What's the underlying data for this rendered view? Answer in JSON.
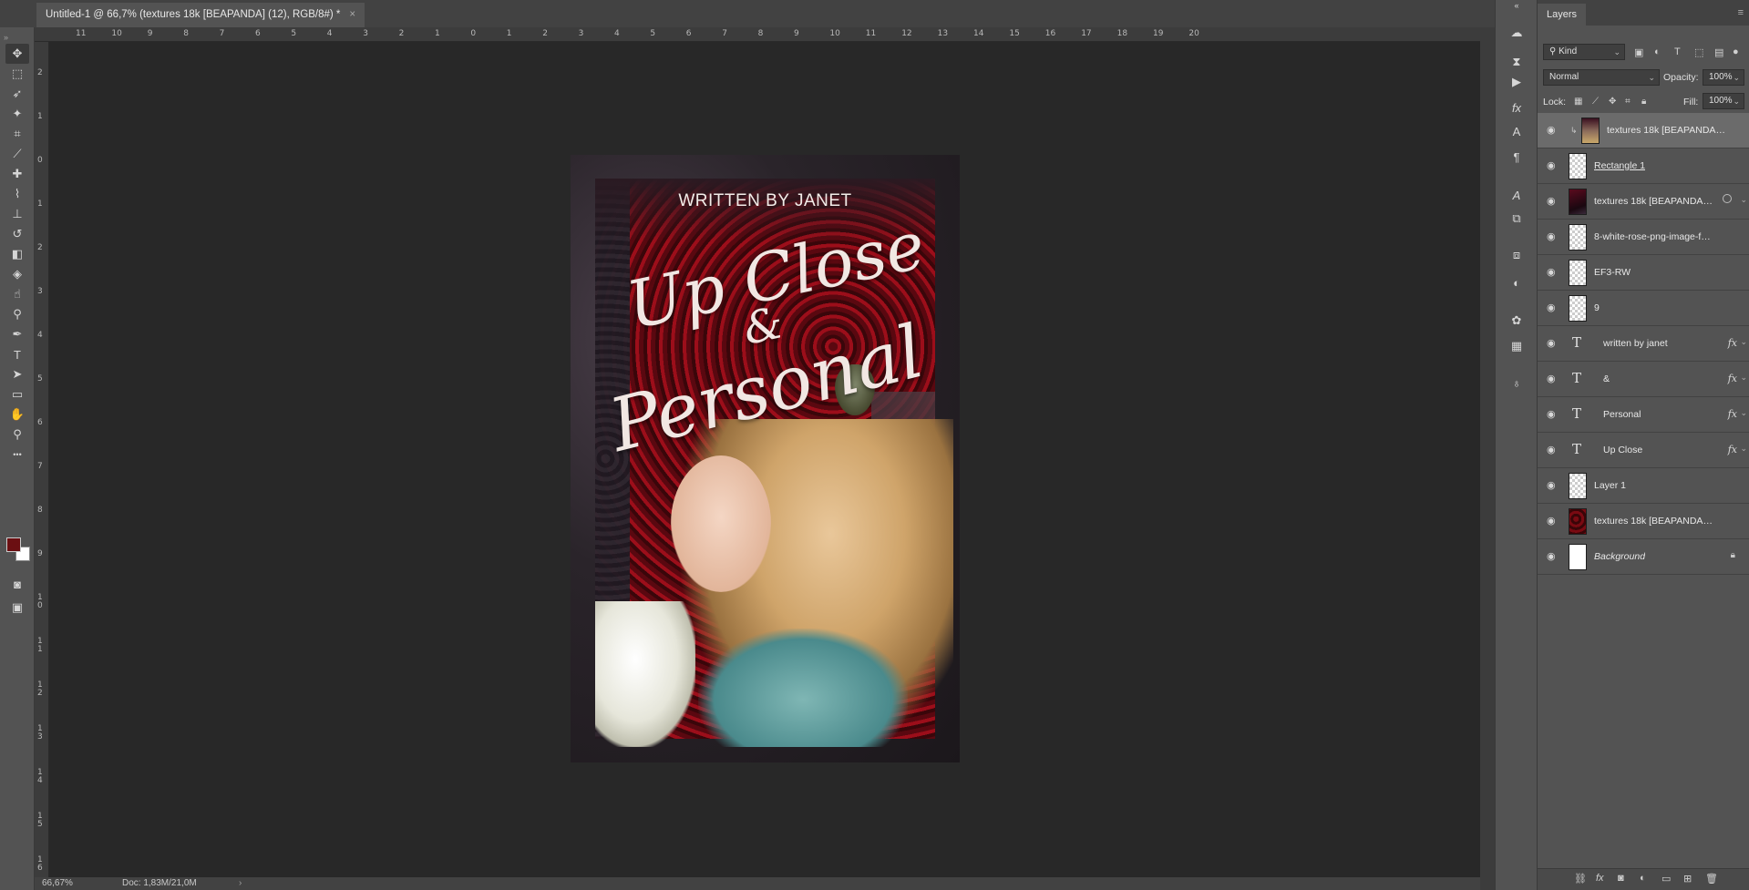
{
  "document_tab": {
    "title": "Untitled-1 @ 66,7% (textures 18k [BEAPANDA] (12), RGB/8#) *",
    "close": "×"
  },
  "tools": [
    {
      "icon": "move-icon",
      "glyph": "✥"
    },
    {
      "icon": "marquee-icon",
      "glyph": "⬚"
    },
    {
      "icon": "lasso-icon",
      "glyph": "➶"
    },
    {
      "icon": "magic-wand-icon",
      "glyph": "✦"
    },
    {
      "icon": "crop-icon",
      "glyph": "⌗"
    },
    {
      "icon": "eyedropper-icon",
      "glyph": "⟋"
    },
    {
      "icon": "healing-brush-icon",
      "glyph": "✚"
    },
    {
      "icon": "brush-icon",
      "glyph": "⌇"
    },
    {
      "icon": "clone-stamp-icon",
      "glyph": "⊥"
    },
    {
      "icon": "history-brush-icon",
      "glyph": "↺"
    },
    {
      "icon": "eraser-icon",
      "glyph": "◧"
    },
    {
      "icon": "paint-bucket-icon",
      "glyph": "◈"
    },
    {
      "icon": "smudge-icon",
      "glyph": "☝"
    },
    {
      "icon": "dodge-icon",
      "glyph": "⚲"
    },
    {
      "icon": "pen-icon",
      "glyph": "✒"
    },
    {
      "icon": "type-icon",
      "glyph": "T"
    },
    {
      "icon": "path-selection-icon",
      "glyph": "➤"
    },
    {
      "icon": "rectangle-icon",
      "glyph": "▭"
    },
    {
      "icon": "hand-icon",
      "glyph": "✋"
    },
    {
      "icon": "zoom-icon",
      "glyph": "⚲"
    },
    {
      "icon": "more-tools-icon",
      "glyph": "•••"
    }
  ],
  "colors": {
    "foreground": "#6b0f12",
    "background": "#ffffff"
  },
  "ruler_top": [
    "11",
    "10",
    "9",
    "8",
    "7",
    "6",
    "5",
    "4",
    "3",
    "2",
    "1",
    "0",
    "1",
    "2",
    "3",
    "4",
    "5",
    "6",
    "7",
    "8",
    "9",
    "10",
    "11",
    "12",
    "13",
    "14",
    "15",
    "16",
    "17",
    "18",
    "19",
    "20"
  ],
  "ruler_left": [
    "2",
    "1",
    "0",
    "1",
    "2",
    "3",
    "4",
    "5",
    "6",
    "7",
    "8",
    "9",
    "1 0",
    "1 1",
    "1 2",
    "1 3",
    "1 4",
    "1 5",
    "1 6"
  ],
  "status": {
    "zoom": "66,67%",
    "doc": "Doc: 1,83M/21,0M",
    "arrow": "›"
  },
  "poster": {
    "written_by": "WRITTEN BY JANET",
    "title_line1": "Up Close",
    "ampersand": "&",
    "title_line2": "Personal"
  },
  "layers_panel": {
    "tab_label": "Layers",
    "filter_kind": "Kind",
    "blend_mode": "Normal",
    "opacity_label": "Opacity:",
    "opacity_value": "100%",
    "lock_label": "Lock:",
    "fill_label": "Fill:",
    "fill_value": "100%",
    "layers": [
      {
        "name": "textures 18k [BEAPANDA]...",
        "thumb": "photo",
        "selected": true,
        "clipped": true,
        "fx": false,
        "type": "smart"
      },
      {
        "name": "Rectangle 1",
        "thumb": "checker",
        "selected": false,
        "fx": false,
        "type": "shape",
        "underline": true
      },
      {
        "name": "textures 18k [BEAPANDA]...",
        "thumb": "dark",
        "selected": false,
        "fx": false,
        "type": "smart",
        "linked": true
      },
      {
        "name": "8-white-rose-png-image-flow...",
        "thumb": "checker",
        "selected": false,
        "fx": false,
        "type": "smart"
      },
      {
        "name": "EF3-RW",
        "thumb": "checker",
        "selected": false,
        "fx": false,
        "type": "smart"
      },
      {
        "name": "9",
        "thumb": "checker",
        "selected": false,
        "fx": false,
        "type": "smart"
      },
      {
        "name": "written by janet",
        "thumb": "text",
        "selected": false,
        "fx": true,
        "type": "text"
      },
      {
        "name": "&",
        "thumb": "text",
        "selected": false,
        "fx": true,
        "type": "text"
      },
      {
        "name": "Personal",
        "thumb": "text",
        "selected": false,
        "fx": true,
        "type": "text"
      },
      {
        "name": "Up Close",
        "thumb": "text",
        "selected": false,
        "fx": true,
        "type": "text"
      },
      {
        "name": "Layer 1",
        "thumb": "checker",
        "selected": false,
        "fx": false,
        "type": "pixel"
      },
      {
        "name": "textures 18k [BEAPANDA] (2...",
        "thumb": "red",
        "selected": false,
        "fx": false,
        "type": "smart"
      },
      {
        "name": "Background",
        "thumb": "white",
        "selected": false,
        "fx": false,
        "type": "background",
        "italic": true,
        "locked": true
      }
    ]
  }
}
